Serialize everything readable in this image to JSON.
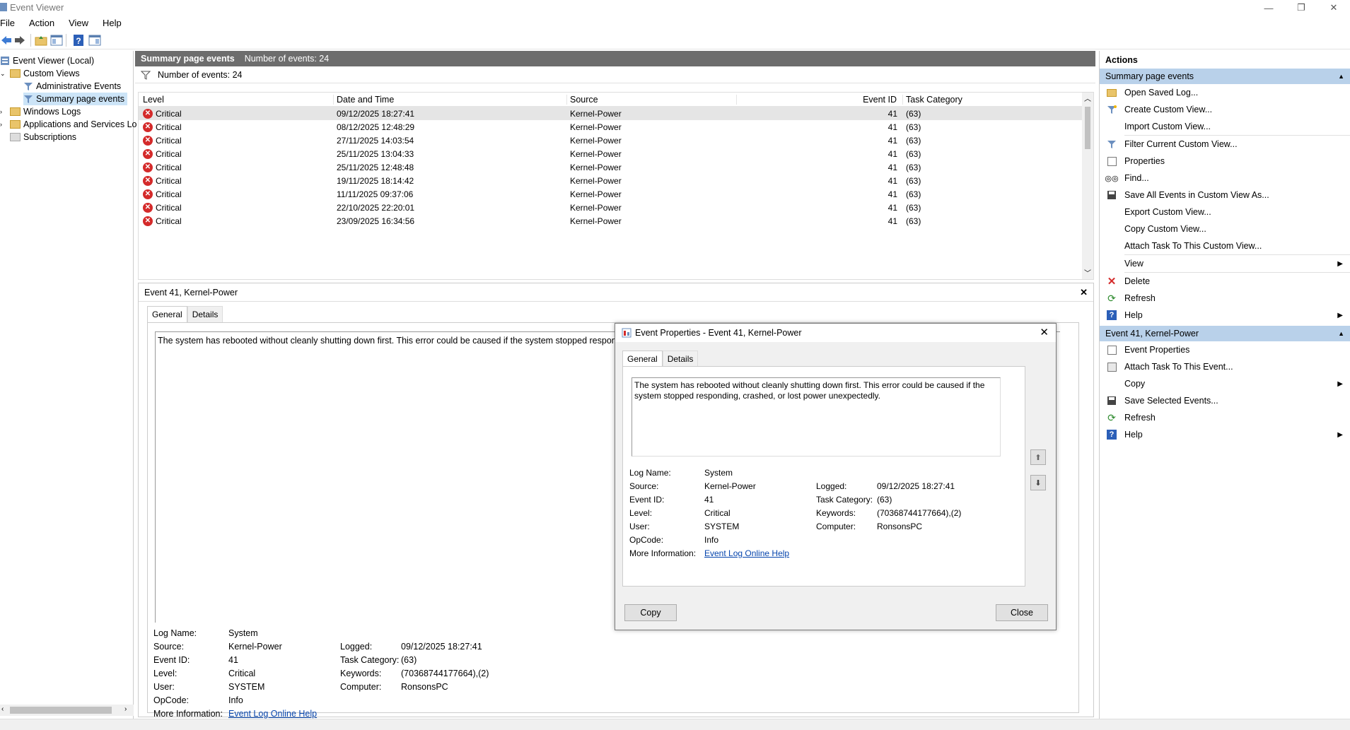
{
  "window": {
    "title": "Event Viewer",
    "min": "—",
    "restore": "❐",
    "close": "✕"
  },
  "menu": [
    "File",
    "Action",
    "View",
    "Help"
  ],
  "tree": {
    "root": "Event Viewer (Local)",
    "custom_views": "Custom Views",
    "admin_events": "Administrative Events",
    "summary_events": "Summary page events",
    "windows_logs": "Windows Logs",
    "apps_services": "Applications and Services Lo",
    "subscriptions": "Subscriptions"
  },
  "center": {
    "header_title": "Summary page events",
    "header_count": "Number of events: 24",
    "filter_count": "Number of events: 24",
    "columns": {
      "level": "Level",
      "date": "Date and Time",
      "source": "Source",
      "id": "Event ID",
      "task": "Task Category"
    },
    "rows": [
      {
        "level": "Critical",
        "date": "09/12/2025 18:27:41",
        "source": "Kernel-Power",
        "id": "41",
        "task": "(63)"
      },
      {
        "level": "Critical",
        "date": "08/12/2025 12:48:29",
        "source": "Kernel-Power",
        "id": "41",
        "task": "(63)"
      },
      {
        "level": "Critical",
        "date": "27/11/2025 14:03:54",
        "source": "Kernel-Power",
        "id": "41",
        "task": "(63)"
      },
      {
        "level": "Critical",
        "date": "25/11/2025 13:04:33",
        "source": "Kernel-Power",
        "id": "41",
        "task": "(63)"
      },
      {
        "level": "Critical",
        "date": "25/11/2025 12:48:48",
        "source": "Kernel-Power",
        "id": "41",
        "task": "(63)"
      },
      {
        "level": "Critical",
        "date": "19/11/2025 18:14:42",
        "source": "Kernel-Power",
        "id": "41",
        "task": "(63)"
      },
      {
        "level": "Critical",
        "date": "11/11/2025 09:37:06",
        "source": "Kernel-Power",
        "id": "41",
        "task": "(63)"
      },
      {
        "level": "Critical",
        "date": "22/10/2025 22:20:01",
        "source": "Kernel-Power",
        "id": "41",
        "task": "(63)"
      },
      {
        "level": "Critical",
        "date": "23/09/2025 16:34:56",
        "source": "Kernel-Power",
        "id": "41",
        "task": "(63)"
      }
    ],
    "detail_title": "Event 41, Kernel-Power",
    "tab_general": "General",
    "tab_details": "Details",
    "message": "The system has rebooted without cleanly shutting down first. This error could be caused if the system stopped responding, crashed, or lost power unexpectedly."
  },
  "props": {
    "log_name_label": "Log Name:",
    "log_name": "System",
    "source_label": "Source:",
    "source": "Kernel-Power",
    "logged_label": "Logged:",
    "logged": "09/12/2025 18:27:41",
    "event_id_label": "Event ID:",
    "event_id": "41",
    "task_label": "Task Category:",
    "task": "(63)",
    "level_label": "Level:",
    "level": "Critical",
    "keywords_label": "Keywords:",
    "keywords": "(70368744177664),(2)",
    "user_label": "User:",
    "user": "SYSTEM",
    "computer_label": "Computer:",
    "computer": "RonsonsPC",
    "opcode_label": "OpCode:",
    "opcode": "Info",
    "moreinfo_label": "More Information:",
    "moreinfo_link": "Event Log Online Help"
  },
  "dialog": {
    "title": "Event Properties - Event 41, Kernel-Power",
    "tab_general": "General",
    "tab_details": "Details",
    "message": "The system has rebooted without cleanly shutting down first. This error could be caused if the system stopped responding, crashed, or lost power unexpectedly.",
    "copy": "Copy",
    "close": "Close"
  },
  "actions": {
    "header": "Actions",
    "section1": "Summary page events",
    "items1": [
      "Open Saved Log...",
      "Create Custom View...",
      "Import Custom View...",
      "Filter Current Custom View...",
      "Properties",
      "Find...",
      "Save All Events in Custom View As...",
      "Export Custom View...",
      "Copy Custom View...",
      "Attach Task To This Custom View...",
      "View",
      "Delete",
      "Refresh",
      "Help"
    ],
    "section2": "Event 41, Kernel-Power",
    "items2": [
      "Event Properties",
      "Attach Task To This Event...",
      "Copy",
      "Save Selected Events...",
      "Refresh",
      "Help"
    ]
  }
}
